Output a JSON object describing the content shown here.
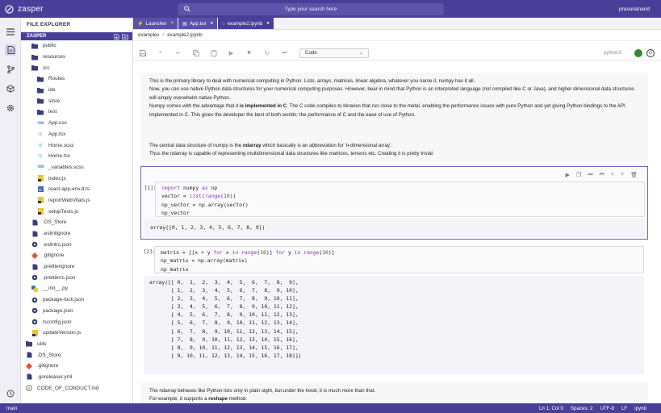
{
  "app": {
    "name": "zasper",
    "user": "prasunanand"
  },
  "search": {
    "placeholder": "Type your search here"
  },
  "explorer": {
    "title": "FILE EXPLORER",
    "root": "ZASPER",
    "items": [
      {
        "label": "public",
        "type": "folder",
        "depth": 2
      },
      {
        "label": "resources",
        "type": "folder",
        "depth": 2
      },
      {
        "label": "src",
        "type": "folder",
        "depth": 2
      },
      {
        "label": "Routes",
        "type": "folder",
        "depth": 3
      },
      {
        "label": "ide",
        "type": "folder",
        "depth": 3
      },
      {
        "label": "store",
        "type": "folder",
        "depth": 3
      },
      {
        "label": "test",
        "type": "folder",
        "depth": 3
      },
      {
        "label": "App.css",
        "type": "css",
        "depth": 3
      },
      {
        "label": "App.tsx",
        "type": "react",
        "depth": 3
      },
      {
        "label": "Home.scss",
        "type": "react",
        "depth": 3
      },
      {
        "label": "Home.tsx",
        "type": "react",
        "depth": 3
      },
      {
        "label": "_variables.scss",
        "type": "css",
        "depth": 3
      },
      {
        "label": "index.js",
        "type": "js",
        "depth": 3
      },
      {
        "label": "react-app-env.d.ts",
        "type": "ts",
        "depth": 3
      },
      {
        "label": "reportWebVitals.js",
        "type": "js",
        "depth": 3
      },
      {
        "label": "setupTests.js",
        "type": "js",
        "depth": 3
      },
      {
        "label": ".DS_Store",
        "type": "file",
        "depth": 2
      },
      {
        "label": ".eslintignore",
        "type": "file",
        "depth": 2
      },
      {
        "label": ".eslintrc.json",
        "type": "gear",
        "depth": 2
      },
      {
        "label": ".gitignore",
        "type": "git",
        "depth": 2
      },
      {
        "label": ".prettierignore",
        "type": "file",
        "depth": 2
      },
      {
        "label": ".prettierrc.json",
        "type": "gear",
        "depth": 2
      },
      {
        "label": "__init__.py",
        "type": "py",
        "depth": 2
      },
      {
        "label": "package-lock.json",
        "type": "gear",
        "depth": 2
      },
      {
        "label": "package.json",
        "type": "gear",
        "depth": 2
      },
      {
        "label": "tsconfig.json",
        "type": "gear",
        "depth": 2
      },
      {
        "label": "updateVersion.js",
        "type": "js",
        "depth": 2
      },
      {
        "label": "utils",
        "type": "folder",
        "depth": 1
      },
      {
        "label": ".DS_Store",
        "type": "file",
        "depth": 1
      },
      {
        "label": ".gitignore",
        "type": "git",
        "depth": 1
      },
      {
        "label": ".goreleaser.yml",
        "type": "file",
        "depth": 1
      },
      {
        "label": "CODE_OF_CONDUCT.md",
        "type": "info",
        "depth": 1
      }
    ]
  },
  "tabs": [
    {
      "label": "Launcher",
      "close": "×"
    },
    {
      "label": "App.tsx",
      "close": "●"
    },
    {
      "label": "example2.ipynb",
      "close": "●"
    }
  ],
  "breadcrumb": {
    "folder": "examples",
    "sep": "/",
    "file": "example2.ipynb"
  },
  "toolbar": {
    "cell_type": "Code",
    "kernel": "python3"
  },
  "notebook": {
    "md1": {
      "p1": "This is the primary library to deal with numerical computing in Python. Lists, arrays, matrices, linear algebra, whatever you name it, numpy has it all.",
      "p2": "Now, you can use native Python data structures for your numerical computing purposes. However, bear in mind that Python is an interpreted language (not compiled like C or Java), and higher dimensional data structures will simply overwhelm native Python.",
      "p3a": "Numpy comes with the advantage that it ",
      "p3b": "is implemented in C",
      "p3c": ". The C code compiles to binaries that run close to the metal, enabling the performance issues with pure Python and yet giving Python bindings to the API implemented in C. This gives the developer the best of both worlds: the performance of C and the ease of use of Python."
    },
    "md2": {
      "p1a": "The central data structure of numpy is the ",
      "p1b": "ndarray",
      "p1c": " which basically is an abbreviation for 'n-dimensional array'.",
      "p2": "Thus the ndarray is capable of representing multidimensional data structures like matrices, tensors etc. Creating it is pretty trivial:"
    },
    "cell1": {
      "prompt": "[1]:",
      "code": [
        "import numpy as np",
        "vector = list(range(10))",
        "np_vector = np.array(vector)",
        "np_vector"
      ],
      "output": "array([0, 1, 2, 3, 4, 5, 6, 7, 8, 9])"
    },
    "cell2": {
      "prompt": "[2]:",
      "code": [
        "matrix = [[x + y for x in range(10)] for y in range(10)]",
        "np_matrix = np.array(matrix)",
        "np_matrix"
      ],
      "output": [
        "array([[ 0,  1,  2,  3,  4,  5,  6,  7,  8,  9],",
        "       [ 1,  2,  3,  4,  5,  6,  7,  8,  9, 10],",
        "       [ 2,  3,  4,  5,  6,  7,  8,  9, 10, 11],",
        "       [ 3,  4,  5,  6,  7,  8,  9, 10, 11, 12],",
        "       [ 4,  5,  6,  7,  8,  9, 10, 11, 12, 13],",
        "       [ 5,  6,  7,  8,  9, 10, 11, 12, 13, 14],",
        "       [ 6,  7,  8,  9, 10, 11, 12, 13, 14, 15],",
        "       [ 7,  8,  9, 10, 11, 12, 13, 14, 15, 16],",
        "       [ 8,  9, 10, 11, 12, 13, 14, 15, 16, 17],",
        "       [ 9, 10, 11, 12, 13, 14, 15, 16, 17, 18]])"
      ]
    },
    "md3": {
      "p1": "The ndarray behaves like Python lists only in plain sight, but under the hood, it is much more than that.",
      "p2a": "For example, it supports a ",
      "p2b": "reshape",
      "p2c": " method:"
    }
  },
  "status": {
    "branch": "main",
    "position": "Ln 1, Col 0",
    "spaces": "Spaces: 2",
    "encoding": "UTF-8",
    "eol": "LF",
    "lang": "ipynb"
  },
  "colors": {
    "accent": "#4a3f98",
    "kernel_ok": "#2e8b35"
  }
}
